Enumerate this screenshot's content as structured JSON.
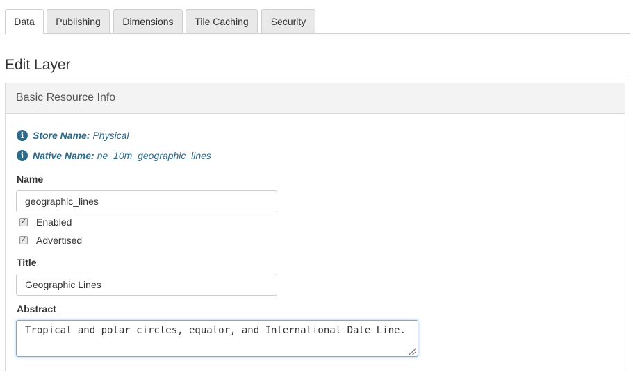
{
  "tabs": [
    {
      "label": "Data",
      "active": true
    },
    {
      "label": "Publishing",
      "active": false
    },
    {
      "label": "Dimensions",
      "active": false
    },
    {
      "label": "Tile Caching",
      "active": false
    },
    {
      "label": "Security",
      "active": false
    }
  ],
  "page": {
    "title": "Edit Layer"
  },
  "panel": {
    "title": "Basic Resource Info",
    "store": {
      "key": "Store Name:",
      "value": "Physical"
    },
    "native": {
      "key": "Native Name:",
      "value": "ne_10m_geographic_lines"
    },
    "name_label": "Name",
    "name_value": "geographic_lines",
    "enabled_label": "Enabled",
    "enabled_checked": true,
    "advertised_label": "Advertised",
    "advertised_checked": true,
    "title_label": "Title",
    "title_value": "Geographic Lines",
    "abstract_label": "Abstract",
    "abstract_value": "Tropical and polar circles, equator, and International Date Line."
  },
  "icons": {
    "info": "info-circle-icon",
    "check": "checkmark-icon"
  },
  "colors": {
    "info_text": "#2b6a8a",
    "focus_border": "#66afe9",
    "tab_bg": "#e9e9e9",
    "panel_header_bg": "#f3f3f3"
  }
}
